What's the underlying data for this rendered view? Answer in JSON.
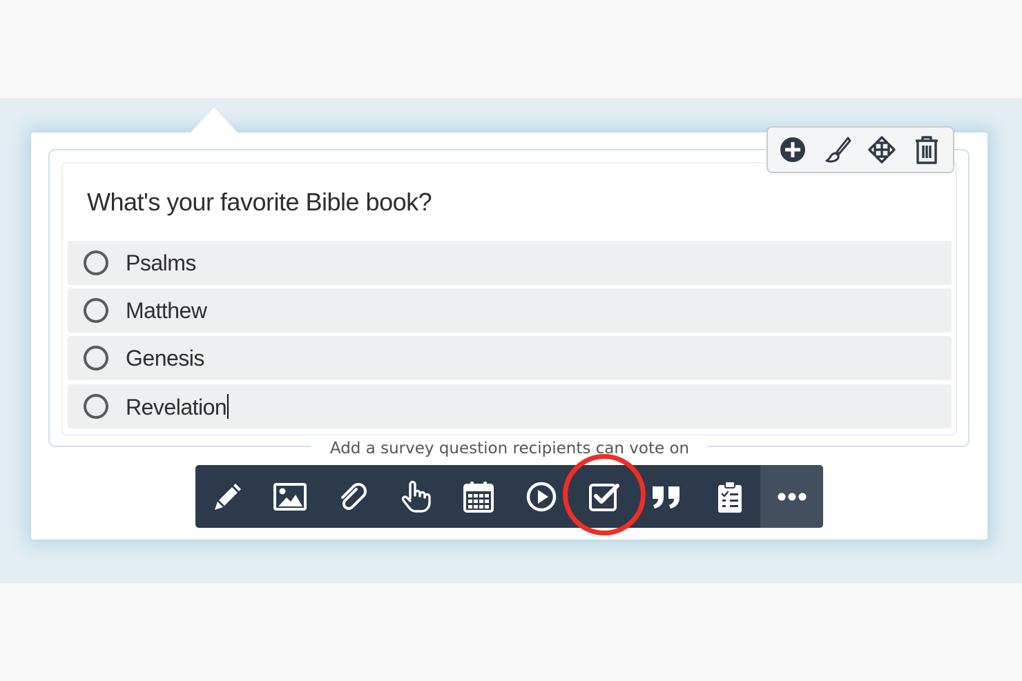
{
  "survey": {
    "question": "What's your favorite Bible book?",
    "options": [
      {
        "label": "Psalms"
      },
      {
        "label": "Matthew"
      },
      {
        "label": "Genesis"
      },
      {
        "label": "Revelation"
      }
    ]
  },
  "tooltip": {
    "text": "Add a survey question recipients can vote on"
  },
  "block_actions": [
    {
      "icon": "add-circle-icon"
    },
    {
      "icon": "paintbrush-icon"
    },
    {
      "icon": "move-arrows-icon"
    },
    {
      "icon": "trash-icon"
    }
  ],
  "toolbar": {
    "tools": [
      {
        "icon": "pencil-icon"
      },
      {
        "icon": "image-icon"
      },
      {
        "icon": "paperclip-icon"
      },
      {
        "icon": "pointing-hand-icon"
      },
      {
        "icon": "calendar-icon"
      },
      {
        "icon": "play-circle-icon"
      },
      {
        "icon": "checkbox-icon",
        "highlighted": true
      },
      {
        "icon": "quote-icon"
      },
      {
        "icon": "clipboard-checklist-icon"
      },
      {
        "icon": "more-dots-icon"
      }
    ]
  },
  "colors": {
    "toolbar_bg": "#2c3a4c",
    "toolbar_more_bg": "#434f5f",
    "highlight_ring": "#ee2e24",
    "outline": "#c9e1ee",
    "option_bg": "#eeeff1"
  }
}
